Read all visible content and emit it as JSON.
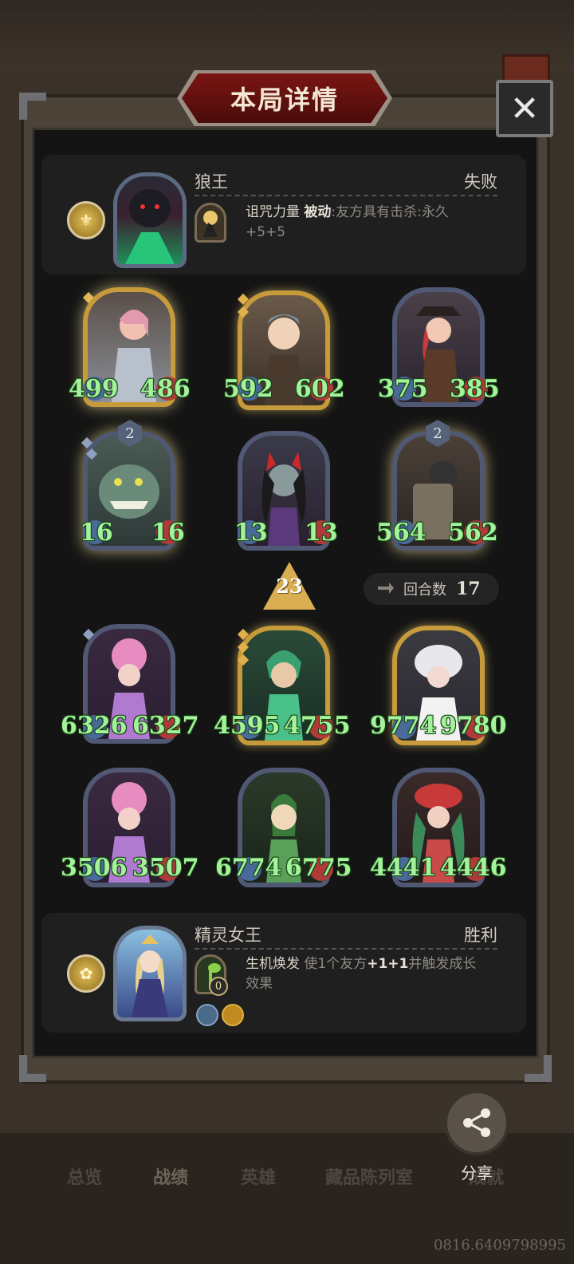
{
  "title": "本局详情",
  "close_icon": "close-icon",
  "top_player": {
    "name": "狼王",
    "result": "失败",
    "skill_name": "诅咒力量",
    "skill_type": "被动",
    "skill_desc_1": ":友方具有击杀:永久",
    "skill_desc_2": "+5+5"
  },
  "top_units": [
    {
      "atk": "499",
      "hp": "486"
    },
    {
      "atk": "592",
      "hp": "602"
    },
    {
      "atk": "375",
      "hp": "385"
    },
    {
      "atk": "16",
      "hp": "16",
      "level": "2"
    },
    {
      "atk": "13",
      "hp": "13"
    },
    {
      "atk": "564",
      "hp": "562",
      "level": "2"
    }
  ],
  "tier": "23",
  "round_label": "回合数",
  "round_count": "17",
  "bottom_units": [
    {
      "atk": "6326",
      "hp": "6327"
    },
    {
      "atk": "4595",
      "hp": "4755"
    },
    {
      "atk": "9774",
      "hp": "9780"
    },
    {
      "atk": "3506",
      "hp": "3507"
    },
    {
      "atk": "6774",
      "hp": "6775"
    },
    {
      "atk": "4441",
      "hp": "4446"
    }
  ],
  "bottom_player": {
    "name": "精灵女王",
    "result": "胜利",
    "skill_name": "生机焕发",
    "skill_desc_1": "使1个友方",
    "skill_bonus": "+1+1",
    "skill_desc_2": "并触发成长",
    "skill_desc_3": "效果",
    "skill_charge": "0"
  },
  "nav_tabs": [
    "总览",
    "战绩",
    "英雄",
    "藏品陈列室",
    "成就"
  ],
  "share_label": "分享",
  "watermark": "0816.6409798995"
}
